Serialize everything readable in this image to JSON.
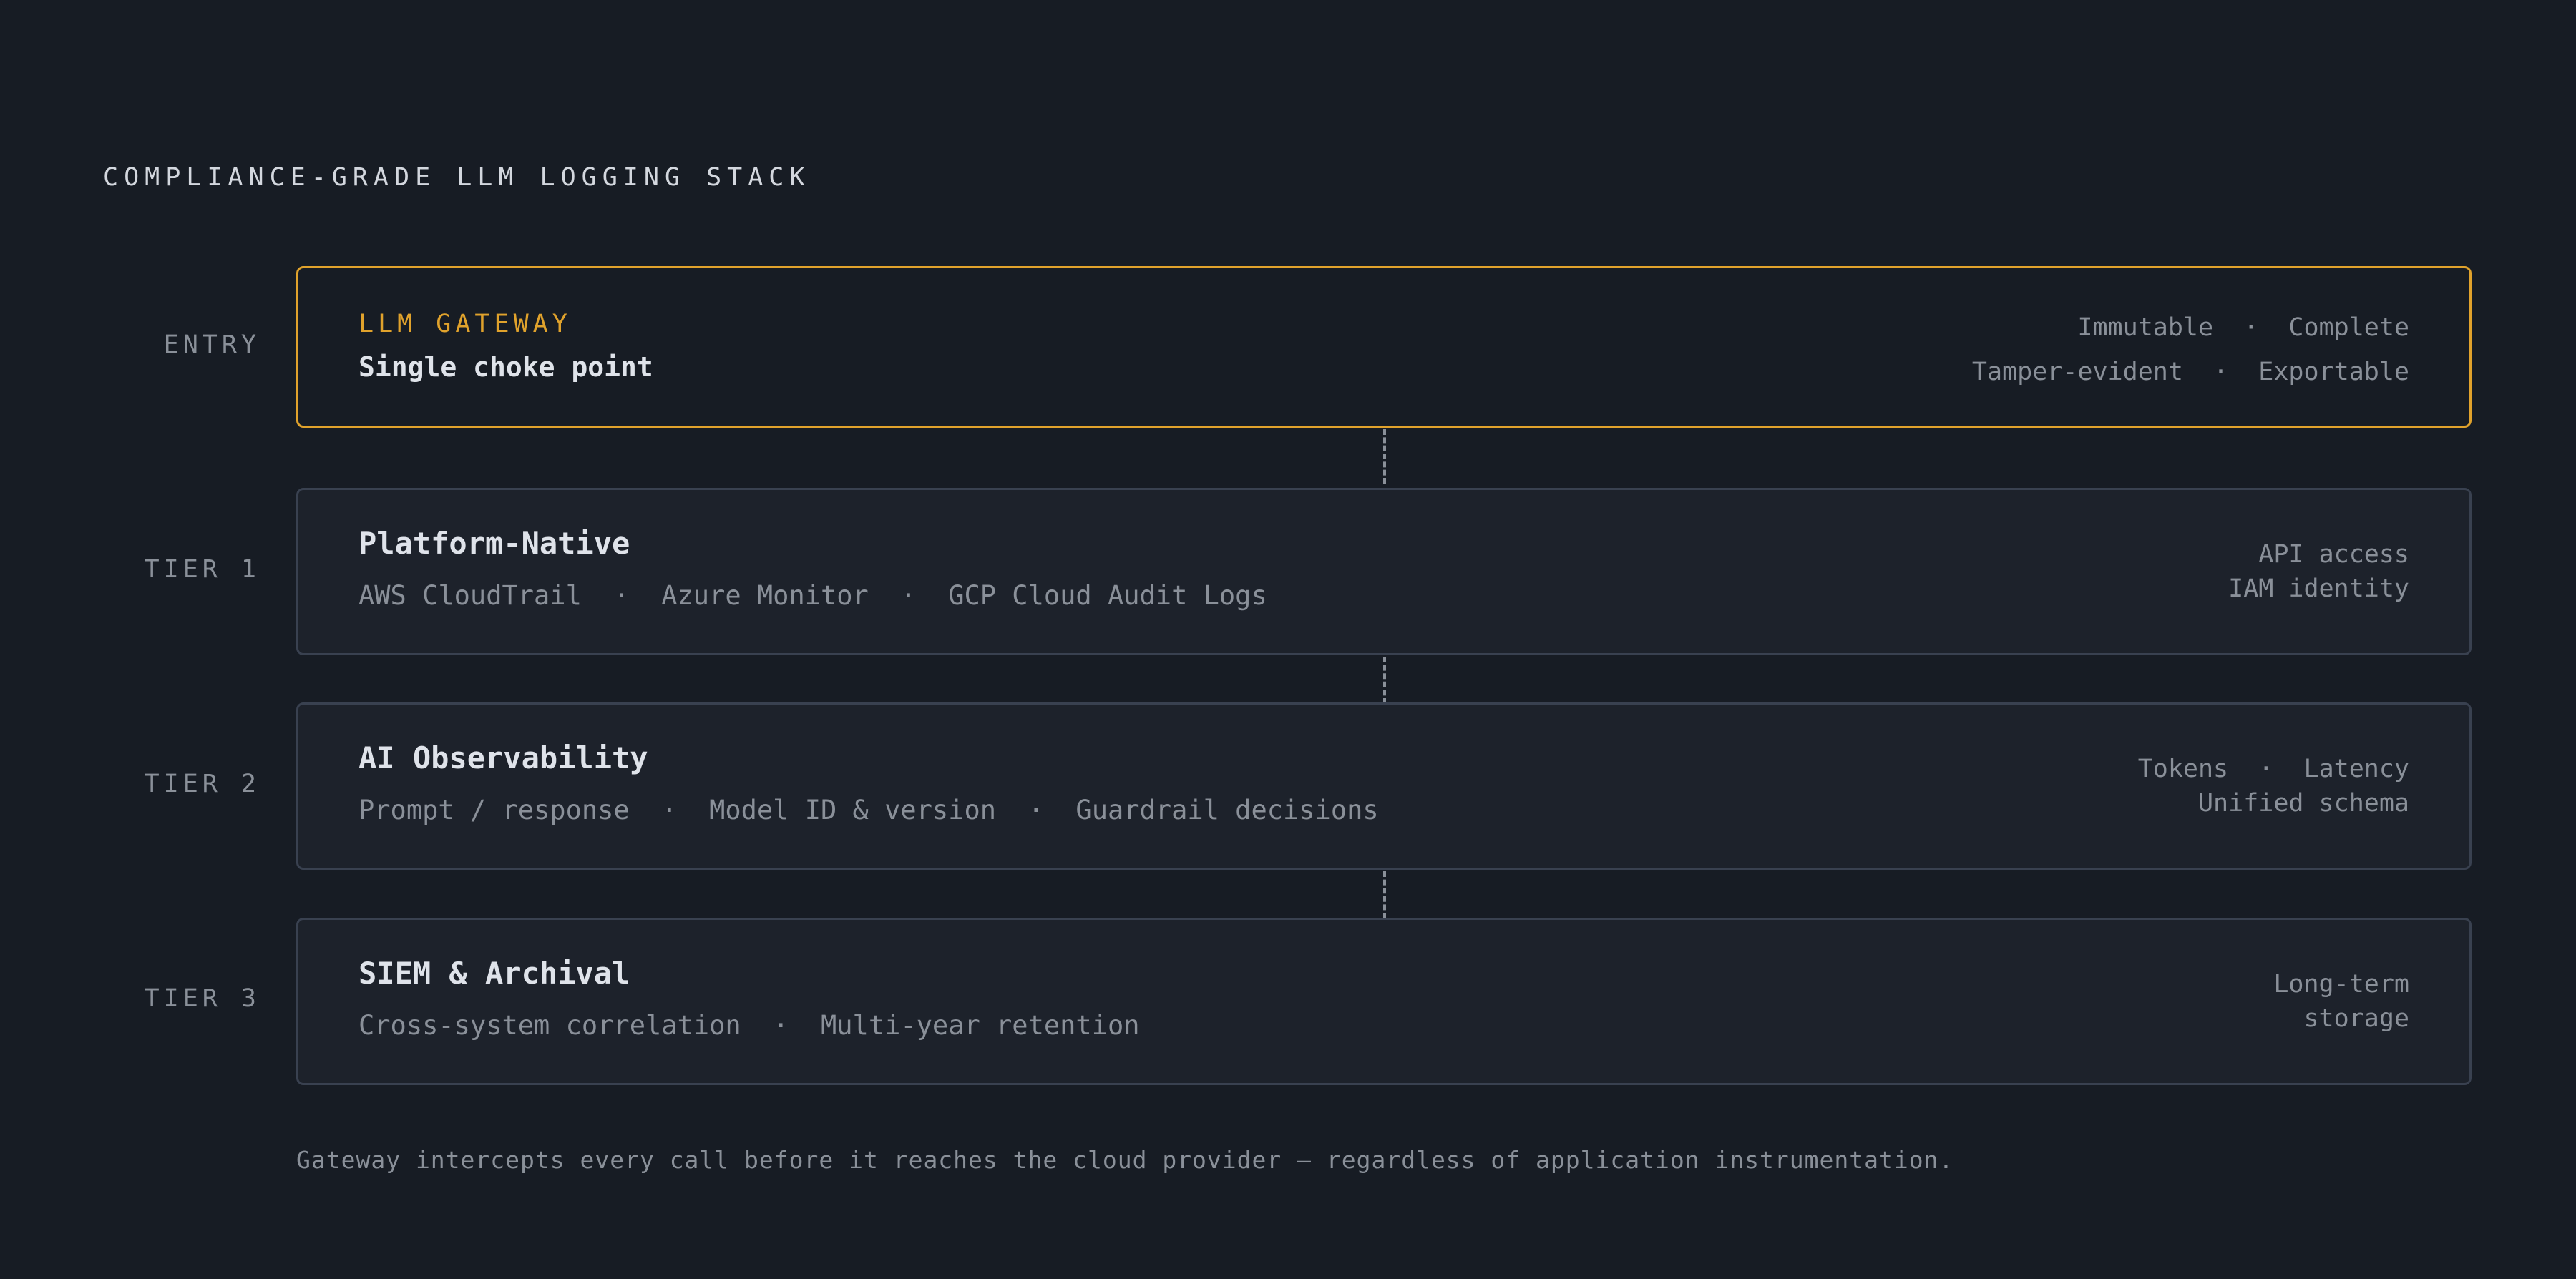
{
  "title": "COMPLIANCE-GRADE LLM LOGGING STACK",
  "entry": {
    "label": "ENTRY",
    "kicker": "LLM GATEWAY",
    "subtitle": "Single choke point",
    "props": [
      "Immutable  ·  Complete",
      "Tamper-evident  ·  Exportable"
    ],
    "accent_color": "#e0a22c"
  },
  "tiers": [
    {
      "label": "TIER 1",
      "name": "Platform-Native",
      "sources": "AWS CloudTrail  ·  Azure Monitor  ·  GCP Cloud Audit Logs",
      "props": [
        "API access",
        "IAM identity"
      ]
    },
    {
      "label": "TIER 2",
      "name": "AI Observability",
      "sources": "Prompt / response  ·  Model ID & version  ·  Guardrail decisions",
      "props": [
        "Tokens  ·  Latency",
        "Unified schema"
      ]
    },
    {
      "label": "TIER 3",
      "name": "SIEM & Archival",
      "sources": "Cross-system correlation  ·  Multi-year retention",
      "props": [
        "Long-term",
        "storage"
      ]
    }
  ],
  "footnote": "Gateway intercepts every call before it reaches the cloud provider — regardless of application instrumentation."
}
